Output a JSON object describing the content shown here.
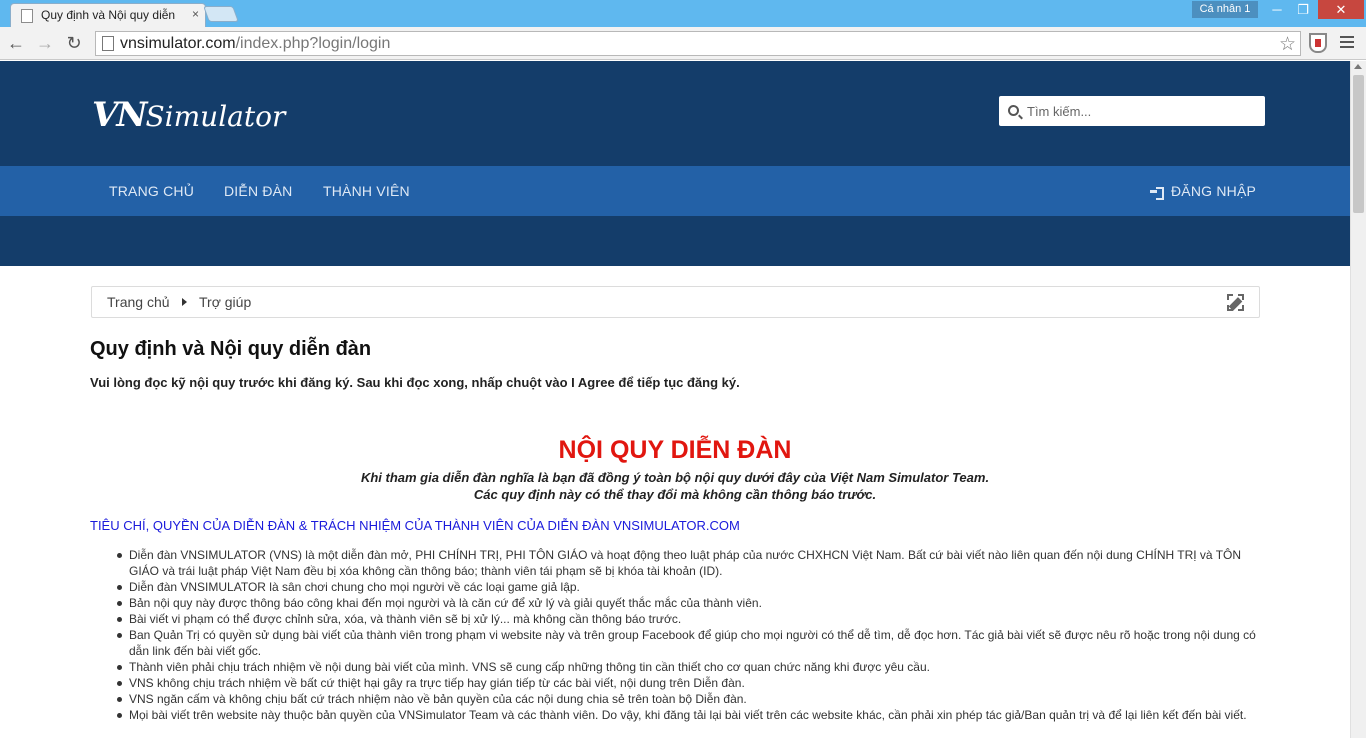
{
  "browser": {
    "tab_title": "Quy định và Nội quy diễn",
    "tab_close": "×",
    "profile": "Cá nhân 1",
    "win_min": "─",
    "win_max": "❐",
    "win_close": "✕",
    "back": "←",
    "forward": "→",
    "reload": "↻",
    "url_host": "vnsimulator.com",
    "url_path": "/index.php?login/login",
    "star": "☆"
  },
  "site": {
    "logo_vn": "VN",
    "logo_sim": "Simulator",
    "search_placeholder": "Tìm kiếm...",
    "nav": {
      "home": "TRANG CHỦ",
      "forums": "DIỄN ĐÀN",
      "members": "THÀNH VIÊN",
      "login": "ĐĂNG NHẬP"
    }
  },
  "breadcrumb": {
    "home": "Trang chủ",
    "help": "Trợ giúp"
  },
  "content": {
    "page_title": "Quy định và Nội quy diễn đàn",
    "intro": "Vui lòng đọc kỹ nội quy trước khi đăng ký. Sau khi đọc xong, nhấp chuột vào I Agree để tiếp tục đăng ký.",
    "rules_title": "NỘI QUY DIỄN ĐÀN",
    "rules_sub1": "Khi tham gia diễn đàn nghĩa là bạn đã đồng ý toàn bộ nội quy dưới đây của Việt Nam Simulator Team.",
    "rules_sub2": "Các quy định này có thể thay đổi mà không cần thông báo trước.",
    "section_heading": "TIÊU CHÍ, QUYỀN CỦA DIỄN ĐÀN & TRÁCH NHIỆM CỦA THÀNH VIÊN CỦA DIỄN ĐÀN VNSIMULATOR.COM",
    "rules": [
      "Diễn đàn VNSIMULATOR (VNS) là một diễn đàn mở, PHI CHÍNH TRỊ, PHI TÔN GIÁO và hoạt động theo luật pháp của nước CHXHCN Việt Nam. Bất cứ bài viết nào liên quan đến nội dung CHÍNH TRỊ và TÔN GIÁO và trái luật pháp Việt Nam đều bị xóa không cần thông báo; thành viên tái phạm sẽ bị khóa tài khoản (ID).",
      "Diễn đàn VNSIMULATOR là sân chơi chung cho mọi người về các loại game giả lập.",
      "Bản nội quy này được thông báo công khai đến mọi người và là căn cứ để xử lý và giải quyết thắc mắc của thành viên.",
      "Bài viết vi phạm có thể được chỉnh sửa, xóa, và thành viên sẽ bị xử lý... mà không cần thông báo trước.",
      "Ban Quản Trị có quyền sử dụng bài viết của thành viên trong phạm vi website này và trên group Facebook để giúp cho mọi người có thể dễ tìm, dễ đọc hơn. Tác giả bài viết sẽ được nêu rõ hoặc trong nội dung có dẫn link đến bài viết gốc.",
      "Thành viên phải chịu trách nhiệm về nội dung bài viết của mình. VNS sẽ cung cấp những thông tin cần thiết cho cơ quan chức năng khi được yêu cầu.",
      "VNS không chịu trách nhiệm về bất cứ thiệt hại gây ra trực tiếp hay gián tiếp từ các bài viết, nội dung trên Diễn đàn.",
      "VNS ngăn cấm và không chịu bất cứ trách nhiệm nào về bản quyền của các nội dung chia sẻ trên toàn bộ Diễn đàn.",
      "Mọi bài viết trên website này thuộc bản quyền của VNSimulator Team và các thành viên. Do vậy, khi đăng tải lại bài viết trên các website khác, cần phải xin phép tác giả/Ban quản trị và để lại liên kết đến bài viết."
    ]
  }
}
